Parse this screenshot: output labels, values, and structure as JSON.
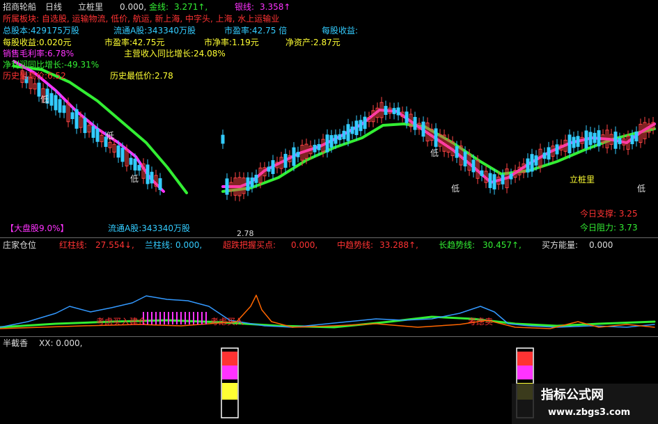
{
  "header": {
    "stock_name": "招商轮船",
    "period": "日线",
    "indicator": "立桩里",
    "ind_val": "0.000,",
    "gold_label": "金线:",
    "gold_val": "3.271↑,",
    "silver_label": "银线:",
    "silver_val": "3.358↑"
  },
  "info": {
    "sector": "所属板块: 自选股, 运输物流, 低价, 航运, 新上海, 中字头, 上海, 水上运输业",
    "total_shares": "总股本:429175万股",
    "float_shares": "流通A股:343340万股",
    "pe1": "市盈率:42.75 倍",
    "eps_label": "每股收益:",
    "eps": "每股收益:0.020元",
    "pe2": "市盈率:42.75元",
    "pb": "市净率:1.19元",
    "nav": "净资产:2.87元",
    "gross_margin": "销售毛利率:6.78%",
    "revenue_growth": "主营收入同比增长:24.08%",
    "profit_growth": "净利润同比增长:-49.31%",
    "hist_high": "历史最高价:6.52",
    "hist_low": "历史最低价:2.78"
  },
  "labels": {
    "low": "低",
    "lizhuang": "立桩里",
    "support": "今日支撑: 3.25",
    "resistance": "今日阻力: 3.73",
    "market_tag": "【大盘股9.0%】",
    "float_tag": "流通A股:343340万股",
    "price_tag": "2.78"
  },
  "panel2": {
    "title": "庄家仓位",
    "red_label": "红柱线:",
    "red_val": "27.554↓,",
    "blue_label": "兰柱线:",
    "blue_val": "0.000,",
    "oversold_label": "超跌把握买点:",
    "oversold_val": "0.000,",
    "mid_label": "中趋势线:",
    "mid_val": "33.288↑,",
    "long_label": "长趋势线:",
    "long_val": "30.457↑,",
    "buy_label": "买方能量:",
    "buy_val": "0.000",
    "annot1": "考虑买入建仓",
    "annot2": "考虑买入",
    "annot3": "考虑卖"
  },
  "panel3": {
    "title": "半截香",
    "xx": "XX: 0.000,"
  },
  "watermark": {
    "title": "指标公式网",
    "url": "www.zbgs3.com"
  },
  "colors": {
    "magenta": "#ff33ff",
    "green": "#33ee33",
    "cyan": "#33ccff",
    "red": "#ff3333",
    "yellow": "#ffff33",
    "blue": "#3399ff",
    "orange": "#ff6600"
  }
}
